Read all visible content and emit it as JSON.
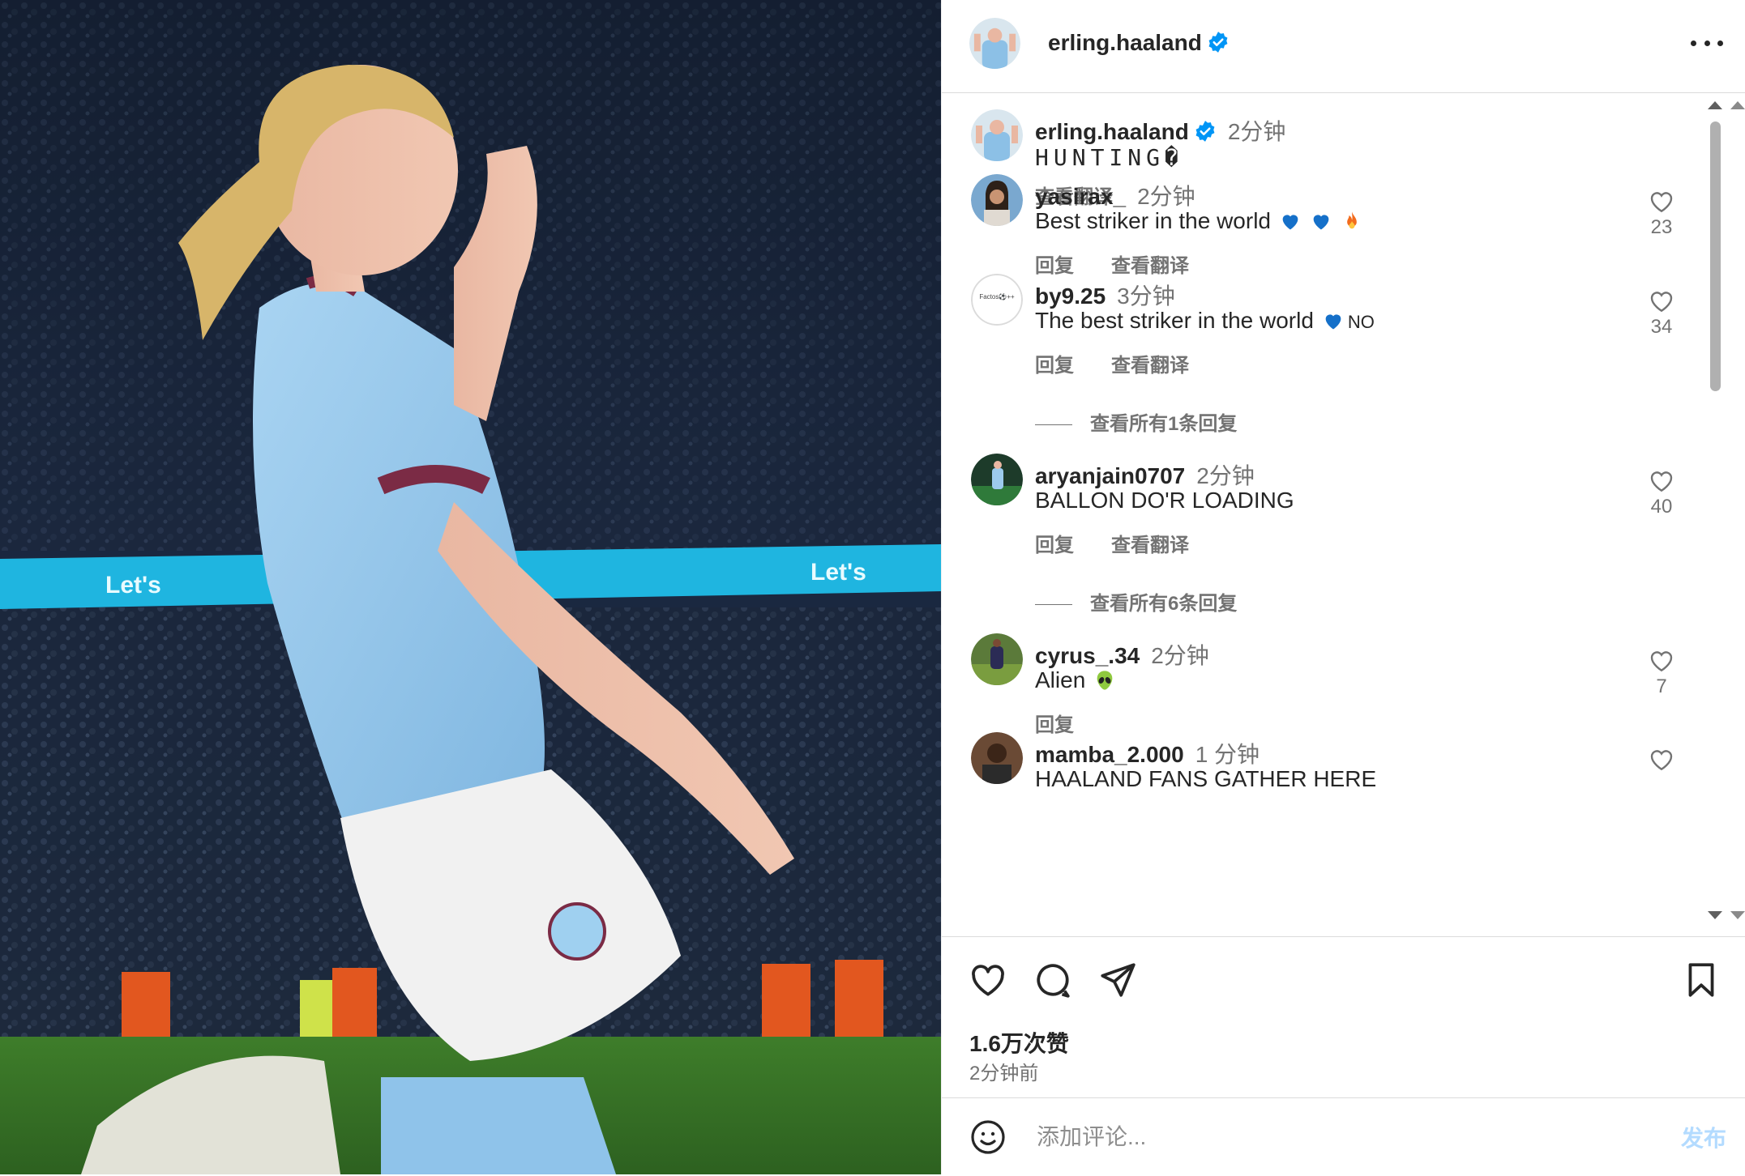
{
  "post": {
    "author": "erling.haaland",
    "caption": "HUNTING\u0000",
    "caption_display": "HUNTING�",
    "caption_time": "2分钟",
    "caption_translate": "查看翻译"
  },
  "comments": [
    {
      "user": "yasirax_",
      "time": "2分钟",
      "text": "Best striker in the world",
      "emojis": [
        "blue-heart",
        "blue-heart",
        "fire"
      ],
      "likes": "23",
      "actions": [
        "回复",
        "查看翻译"
      ]
    },
    {
      "user": "by9.25",
      "time": "3分钟",
      "text": "The best striker in the world",
      "emojis": [
        "blue-heart"
      ],
      "text_suffix": "NO",
      "likes": "34",
      "actions": [
        "回复",
        "查看翻译"
      ],
      "avatar_text": "Factos⚽++",
      "view_replies": "查看所有1条回复"
    },
    {
      "user": "aryanjain0707",
      "time": "2分钟",
      "text": "BALLON DO'R LOADING",
      "likes": "40",
      "actions": [
        "回复",
        "查看翻译"
      ],
      "view_replies": "查看所有6条回复"
    },
    {
      "user": "cyrus_.34",
      "time": "2分钟",
      "text": "Alien",
      "emojis": [
        "alien"
      ],
      "likes": "7",
      "actions": [
        "回复"
      ]
    },
    {
      "user": "mamba_2.000",
      "time": "1 分钟",
      "text": "HAALAND FANS GATHER HERE"
    }
  ],
  "stats": {
    "likes": "1.6万次赞",
    "posted": "2分钟前"
  },
  "composer": {
    "placeholder": "添加评论...",
    "post_label": "发布"
  },
  "icons": {
    "like": "heart-icon",
    "comment": "comment-icon",
    "share": "send-icon",
    "save": "bookmark-icon",
    "emoji": "smile-icon",
    "more": "more-icon",
    "verified": "verified-icon"
  },
  "colors": {
    "verified": "#0095f6",
    "post_button_disabled": "#b3dbff",
    "jersey_sky_blue": "#9ccbed",
    "banner_cyan": "#1fb5e0"
  }
}
